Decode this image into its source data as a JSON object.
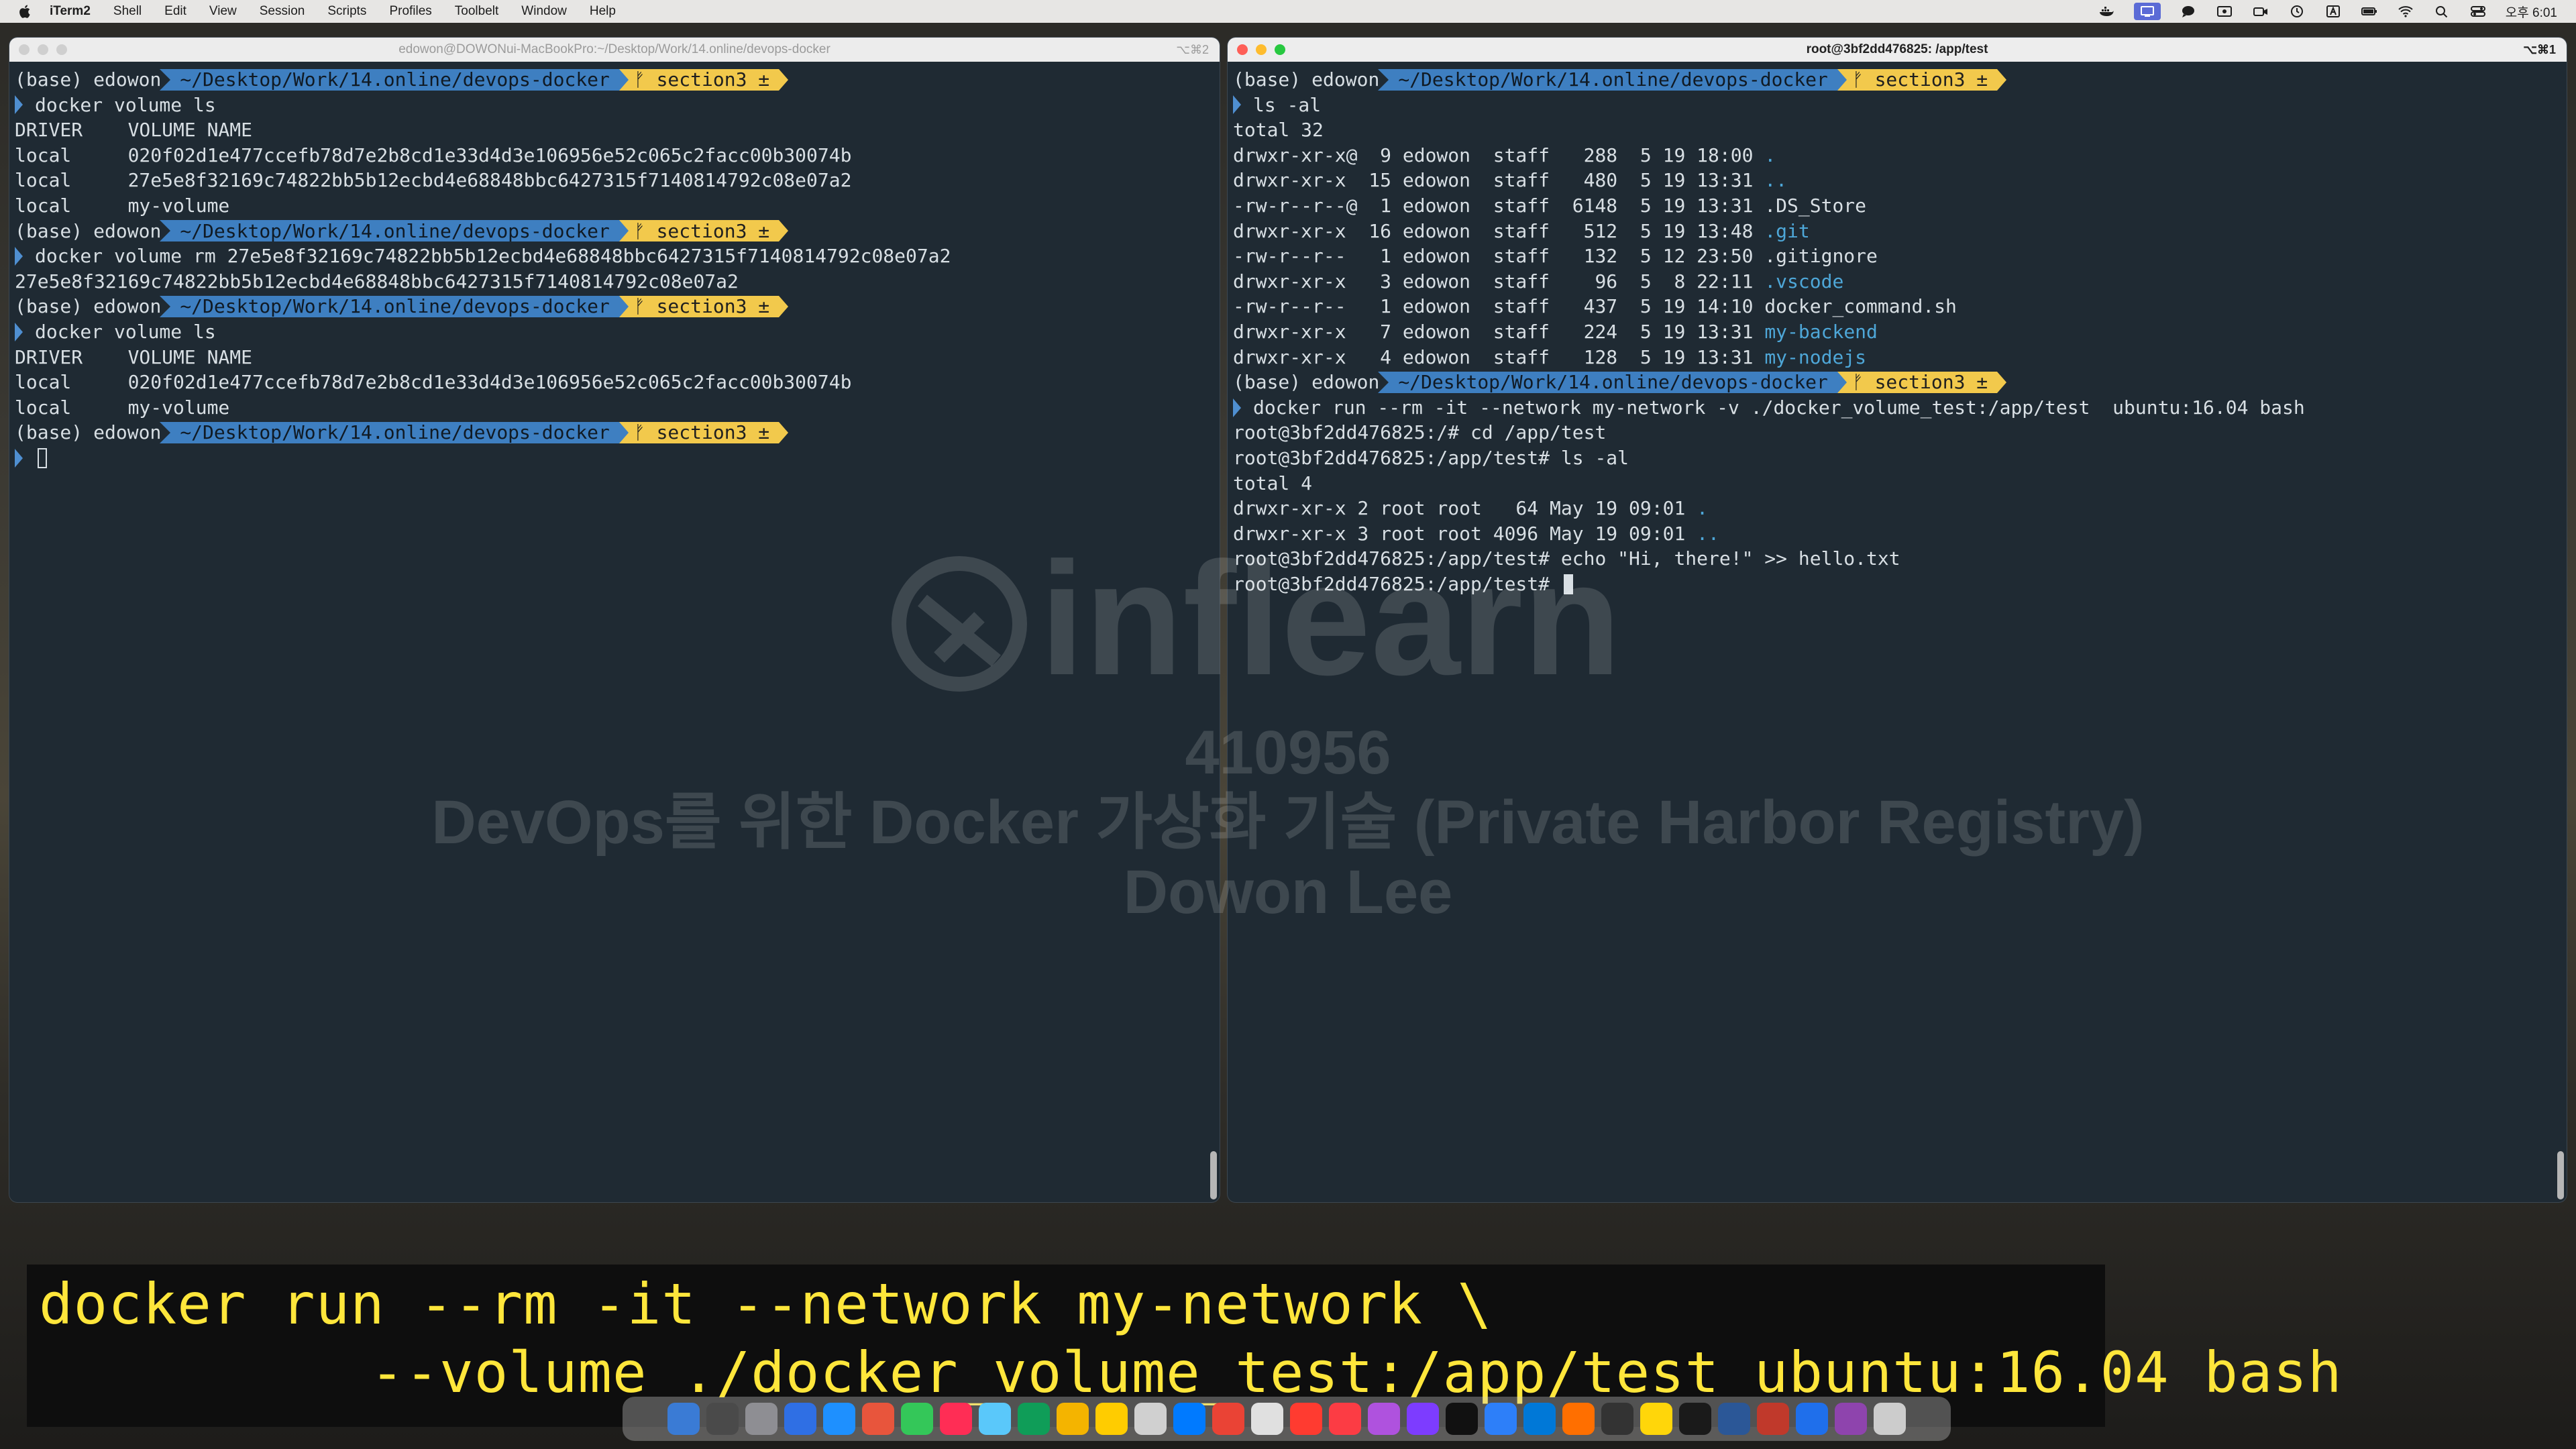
{
  "menubar": {
    "app_name": "iTerm2",
    "items": [
      "Shell",
      "Edit",
      "View",
      "Session",
      "Scripts",
      "Profiles",
      "Toolbelt",
      "Window",
      "Help"
    ],
    "clock": "오후 6:01",
    "status_icons": [
      "docker-icon",
      "screen-share-icon",
      "messages-icon",
      "screen-record-icon",
      "camera-icon",
      "time-machine-icon",
      "keyboard-input-icon",
      "battery-icon",
      "wifi-icon",
      "search-icon",
      "control-center-icon"
    ]
  },
  "left_terminal": {
    "title": "edowon@DOWONui-MacBookPro:~/Desktop/Work/14.online/devops-docker",
    "shortcut": "⌥⌘2",
    "prompt": {
      "base": "(base)",
      "user": "edowon",
      "path": "~/Desktop/Work/14.online/devops-docker",
      "branch": "ᚠ section3 ±"
    },
    "lines": [
      {
        "kind": "prompt"
      },
      {
        "kind": "cmd",
        "text": "docker volume ls"
      },
      {
        "kind": "out",
        "text": "DRIVER    VOLUME NAME"
      },
      {
        "kind": "out",
        "text": "local     020f02d1e477ccefb78d7e2b8cd1e33d4d3e106956e52c065c2facc00b30074b"
      },
      {
        "kind": "out",
        "text": "local     27e5e8f32169c74822bb5b12ecbd4e68848bbc6427315f7140814792c08e07a2"
      },
      {
        "kind": "out",
        "text": "local     my-volume"
      },
      {
        "kind": "prompt"
      },
      {
        "kind": "cmd",
        "text": "docker volume rm 27e5e8f32169c74822bb5b12ecbd4e68848bbc6427315f7140814792c08e07a2"
      },
      {
        "kind": "out",
        "text": "27e5e8f32169c74822bb5b12ecbd4e68848bbc6427315f7140814792c08e07a2"
      },
      {
        "kind": "prompt"
      },
      {
        "kind": "cmd",
        "text": "docker volume ls"
      },
      {
        "kind": "out",
        "text": "DRIVER    VOLUME NAME"
      },
      {
        "kind": "out",
        "text": "local     020f02d1e477ccefb78d7e2b8cd1e33d4d3e106956e52c065c2facc00b30074b"
      },
      {
        "kind": "out",
        "text": "local     my-volume"
      },
      {
        "kind": "prompt"
      },
      {
        "kind": "cursor"
      }
    ]
  },
  "right_terminal": {
    "title": "root@3bf2dd476825: /app/test",
    "shortcut": "⌥⌘1",
    "prompt": {
      "base": "(base)",
      "user": "edowon",
      "path": "~/Desktop/Work/14.online/devops-docker",
      "branch": "ᚠ section3 ±"
    },
    "lines": [
      {
        "kind": "prompt"
      },
      {
        "kind": "cmd",
        "text": "ls -al"
      },
      {
        "kind": "out",
        "text": "total 32"
      },
      {
        "kind": "ls",
        "text": "drwxr-xr-x@  9 edowon  staff   288  5 19 18:00 ",
        "name": "."
      },
      {
        "kind": "ls",
        "text": "drwxr-xr-x  15 edowon  staff   480  5 19 13:31 ",
        "name": ".."
      },
      {
        "kind": "out",
        "text": "-rw-r--r--@  1 edowon  staff  6148  5 19 13:31 .DS_Store"
      },
      {
        "kind": "ls",
        "text": "drwxr-xr-x  16 edowon  staff   512  5 19 13:48 ",
        "name": ".git"
      },
      {
        "kind": "out",
        "text": "-rw-r--r--   1 edowon  staff   132  5 12 23:50 .gitignore"
      },
      {
        "kind": "ls",
        "text": "drwxr-xr-x   3 edowon  staff    96  5  8 22:11 ",
        "name": ".vscode"
      },
      {
        "kind": "out",
        "text": "-rw-r--r--   1 edowon  staff   437  5 19 14:10 docker_command.sh"
      },
      {
        "kind": "ls",
        "text": "drwxr-xr-x   7 edowon  staff   224  5 19 13:31 ",
        "name": "my-backend"
      },
      {
        "kind": "ls",
        "text": "drwxr-xr-x   4 edowon  staff   128  5 19 13:31 ",
        "name": "my-nodejs"
      },
      {
        "kind": "prompt"
      },
      {
        "kind": "cmd",
        "text": "docker run --rm -it --network my-network -v ./docker_volume_test:/app/test  ubuntu:16.04 bash"
      },
      {
        "kind": "out",
        "text": "root@3bf2dd476825:/# cd /app/test"
      },
      {
        "kind": "out",
        "text": "root@3bf2dd476825:/app/test# ls -al"
      },
      {
        "kind": "out",
        "text": "total 4"
      },
      {
        "kind": "ls",
        "text": "drwxr-xr-x 2 root root   64 May 19 09:01 ",
        "name": "."
      },
      {
        "kind": "ls",
        "text": "drwxr-xr-x 3 root root 4096 May 19 09:01 ",
        "name": ".."
      },
      {
        "kind": "out",
        "text": "root@3bf2dd476825:/app/test# echo \"Hi, there!\" >> hello.txt"
      },
      {
        "kind": "rootcursor",
        "text": "root@3bf2dd476825:/app/test# "
      }
    ]
  },
  "watermark": {
    "logo_text": "inflearn",
    "lines": [
      "410956",
      "DevOps를 위한 Docker 가상화 기술 (Private Harbor Registry)",
      "Dowon Lee"
    ]
  },
  "caption": {
    "line1": "docker run --rm -it --network my-network \\",
    "line2": "--volume ./docker_volume_test:/app/test ubuntu:16.04 bash"
  },
  "dock": {
    "colors": [
      "#3a7bd5",
      "#4a4a4a",
      "#8e8e93",
      "#2f6fe4",
      "#1e90ff",
      "#e8553c",
      "#34c759",
      "#ff2d55",
      "#5ac8fa",
      "#0f9d58",
      "#f4b400",
      "#ffcc00",
      "#d0d0d0",
      "#007aff",
      "#ea4335",
      "#e0e0e0",
      "#ff3b30",
      "#fc3c44",
      "#af52de",
      "#7d3cff",
      "#111111",
      "#2d7ff9",
      "#0078d7",
      "#ff6f00",
      "#333333",
      "#ffd60a",
      "#1a1a1a",
      "#2b5797",
      "#c0392b",
      "#1f6feb",
      "#8e44ad",
      "#cccccc"
    ]
  },
  "colors": {
    "terminal_bg": "#1f2a33",
    "path_segment": "#3e7fc1",
    "branch_segment": "#f2c94c",
    "dir_color": "#4ea7d8",
    "caption_text": "#ffe63b"
  }
}
